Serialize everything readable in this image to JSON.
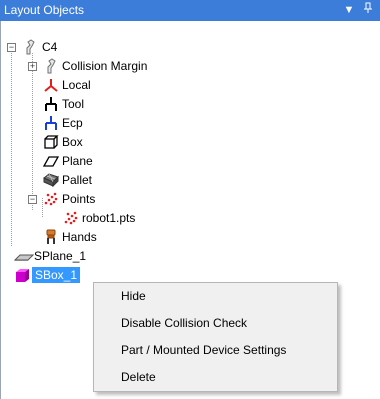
{
  "panel": {
    "title": "Layout Objects",
    "dropdown_icon": "chevron-down-icon",
    "pin_icon": "pin-icon"
  },
  "tree": {
    "root": {
      "label": "C4",
      "icon": "robot-arm-icon",
      "expanded": true
    },
    "items": {
      "collision_margin": {
        "label": "Collision Margin",
        "icon": "robot-arm-icon",
        "expanded": false
      },
      "local": {
        "label": "Local",
        "icon": "local-frame-icon"
      },
      "tool": {
        "label": "Tool",
        "icon": "tool-frame-icon"
      },
      "ecp": {
        "label": "Ecp",
        "icon": "ecp-frame-icon"
      },
      "box": {
        "label": "Box",
        "icon": "box-icon"
      },
      "plane": {
        "label": "Plane",
        "icon": "plane-icon"
      },
      "pallet": {
        "label": "Pallet",
        "icon": "pallet-icon"
      },
      "points": {
        "label": "Points",
        "icon": "points-icon",
        "expanded": true
      },
      "robot1_pts": {
        "label": "robot1.pts",
        "icon": "points-icon"
      },
      "hands": {
        "label": "Hands",
        "icon": "hand-icon"
      }
    },
    "splane": {
      "label": "SPlane_1",
      "icon": "splane-icon"
    },
    "sbox": {
      "label": "SBox_1",
      "icon": "sbox-icon",
      "selected": true
    }
  },
  "context_menu": {
    "items": [
      "Hide",
      "Disable Collision Check",
      "Part / Mounted Device Settings",
      "Delete"
    ]
  },
  "colors": {
    "titlebar": "#3b7dd8",
    "selection": "#3399ff",
    "sbox": "#cc00cc",
    "frame_red": "#e02020",
    "frame_blue": "#1a3fd6"
  }
}
